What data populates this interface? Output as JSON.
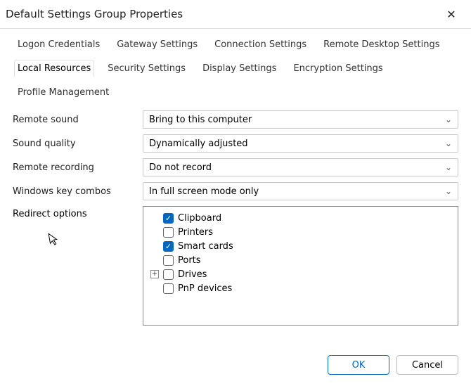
{
  "window": {
    "title": "Default Settings Group Properties"
  },
  "tabs": {
    "row1": [
      "Logon Credentials",
      "Gateway Settings",
      "Connection Settings",
      "Remote Desktop Settings"
    ],
    "row2": [
      "Local Resources",
      "Security Settings",
      "Display Settings",
      "Encryption Settings",
      "Profile Management"
    ],
    "selected": "Local Resources"
  },
  "form": {
    "remote_sound": {
      "label": "Remote sound",
      "value": "Bring to this computer"
    },
    "sound_quality": {
      "label": "Sound quality",
      "value": "Dynamically adjusted"
    },
    "remote_recording": {
      "label": "Remote recording",
      "value": "Do not record"
    },
    "windows_key": {
      "label": "Windows key combos",
      "value": "In full screen mode only"
    },
    "redirect": {
      "label": "Redirect options",
      "items": [
        {
          "label": "Clipboard",
          "checked": true,
          "expandable": false
        },
        {
          "label": "Printers",
          "checked": false,
          "expandable": false
        },
        {
          "label": "Smart cards",
          "checked": true,
          "expandable": false
        },
        {
          "label": "Ports",
          "checked": false,
          "expandable": false
        },
        {
          "label": "Drives",
          "checked": false,
          "expandable": true
        },
        {
          "label": "PnP devices",
          "checked": false,
          "expandable": false
        }
      ]
    }
  },
  "footer": {
    "ok": "OK",
    "cancel": "Cancel"
  }
}
